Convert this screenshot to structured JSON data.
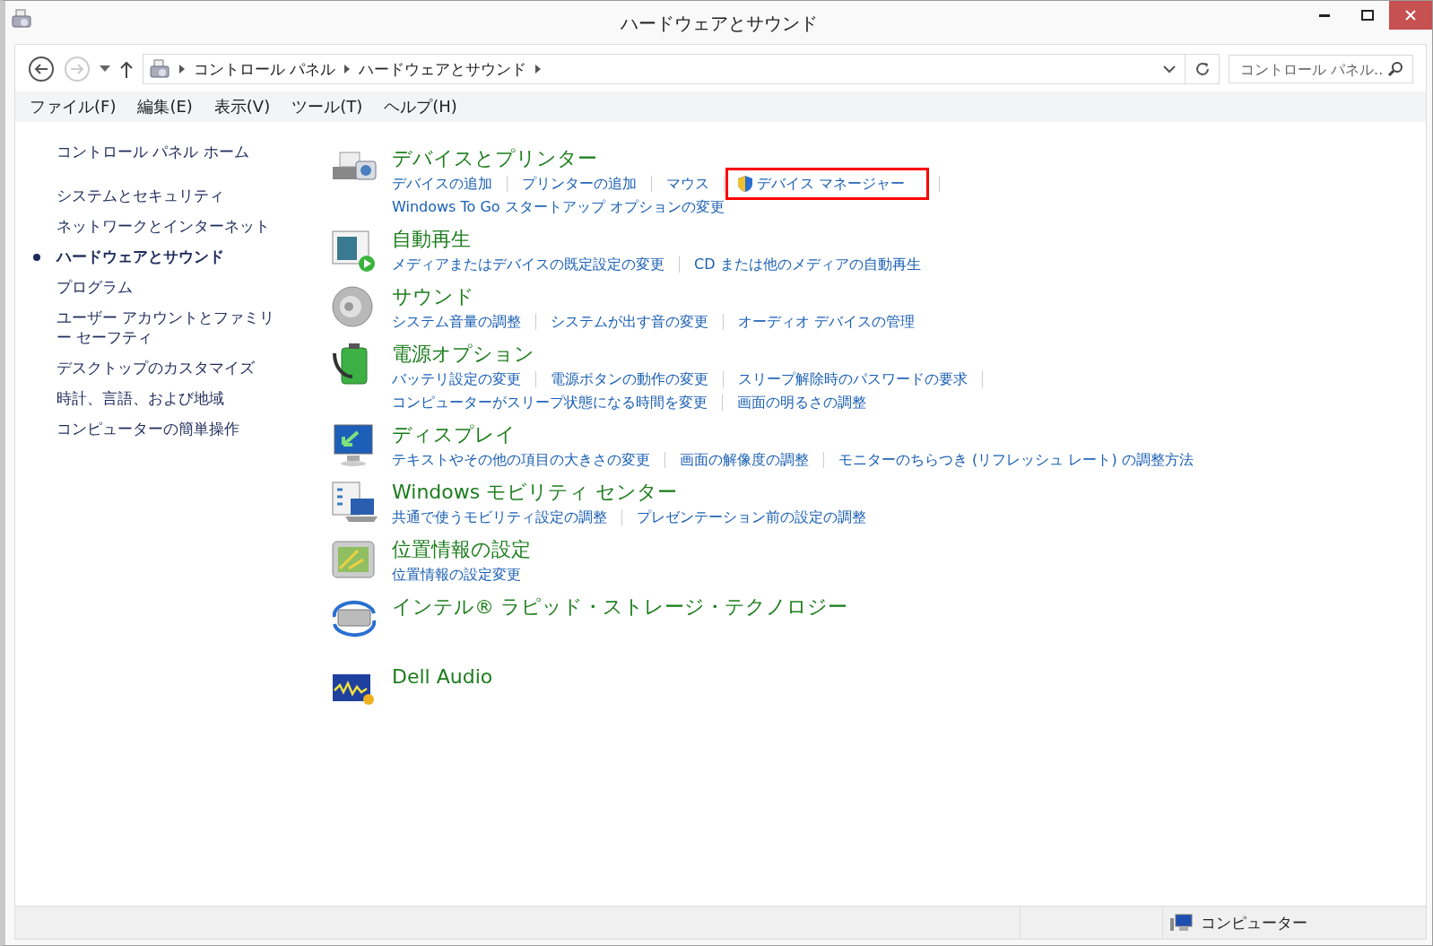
{
  "window": {
    "title": "ハードウェアとサウンド"
  },
  "address_bar": {
    "crumbs": [
      "コントロール パネル",
      "ハードウェアとサウンド"
    ],
    "search_placeholder": "コントロール パネル..."
  },
  "menu": [
    "ファイル(F)",
    "編集(E)",
    "表示(V)",
    "ツール(T)",
    "ヘルプ(H)"
  ],
  "sidebar": {
    "home": "コントロール パネル ホーム",
    "items": [
      {
        "label": "システムとセキュリティ",
        "selected": false
      },
      {
        "label": "ネットワークとインターネット",
        "selected": false
      },
      {
        "label": "ハードウェアとサウンド",
        "selected": true
      },
      {
        "label": "プログラム",
        "selected": false
      },
      {
        "label": "ユーザー アカウントとファミリー セーフティ",
        "selected": false
      },
      {
        "label": "デスクトップのカスタマイズ",
        "selected": false
      },
      {
        "label": "時計、言語、および地域",
        "selected": false
      },
      {
        "label": "コンピューターの簡単操作",
        "selected": false
      }
    ]
  },
  "categories": [
    {
      "title": "デバイスとプリンター",
      "lines": [
        [
          {
            "text": "デバイスの追加",
            "kind": "plain",
            "highlighted": false
          },
          {
            "text": "プリンターの追加",
            "kind": "plain",
            "highlighted": false
          },
          {
            "text": "マウス",
            "kind": "plain",
            "highlighted": false
          },
          {
            "text": "デバイス マネージャー",
            "kind": "shield",
            "highlighted": true
          }
        ],
        [
          {
            "text": "Windows To Go スタートアップ オプションの変更",
            "kind": "plain",
            "highlighted": false
          }
        ]
      ]
    },
    {
      "title": "自動再生",
      "lines": [
        [
          {
            "text": "メディアまたはデバイスの既定設定の変更",
            "kind": "plain",
            "highlighted": false
          },
          {
            "text": "CD または他のメディアの自動再生",
            "kind": "plain",
            "highlighted": false
          }
        ]
      ]
    },
    {
      "title": "サウンド",
      "lines": [
        [
          {
            "text": "システム音量の調整",
            "kind": "plain",
            "highlighted": false
          },
          {
            "text": "システムが出す音の変更",
            "kind": "plain",
            "highlighted": false
          },
          {
            "text": "オーディオ デバイスの管理",
            "kind": "plain",
            "highlighted": false
          }
        ]
      ]
    },
    {
      "title": "電源オプション",
      "lines": [
        [
          {
            "text": "バッテリ設定の変更",
            "kind": "plain",
            "highlighted": false
          },
          {
            "text": "電源ボタンの動作の変更",
            "kind": "plain",
            "highlighted": false
          },
          {
            "text": "スリープ解除時のパスワードの要求",
            "kind": "plain",
            "highlighted": false
          }
        ],
        [
          {
            "text": "コンピューターがスリープ状態になる時間を変更",
            "kind": "plain",
            "highlighted": false
          },
          {
            "text": "画面の明るさの調整",
            "kind": "plain",
            "highlighted": false
          }
        ]
      ]
    },
    {
      "title": "ディスプレイ",
      "lines": [
        [
          {
            "text": "テキストやその他の項目の大きさの変更",
            "kind": "plain",
            "highlighted": false
          },
          {
            "text": "画面の解像度の調整",
            "kind": "plain",
            "highlighted": false
          },
          {
            "text": "モニターのちらつき (リフレッシュ レート) の調整方法",
            "kind": "plain",
            "highlighted": false
          }
        ]
      ]
    },
    {
      "title": "Windows モビリティ センター",
      "lines": [
        [
          {
            "text": "共通で使うモビリティ設定の調整",
            "kind": "plain",
            "highlighted": false
          },
          {
            "text": "プレゼンテーション前の設定の調整",
            "kind": "plain",
            "highlighted": false
          }
        ]
      ]
    },
    {
      "title": "位置情報の設定",
      "lines": [
        [
          {
            "text": "位置情報の設定変更",
            "kind": "plain",
            "highlighted": false
          }
        ]
      ]
    },
    {
      "title": "インテル® ラピッド・ストレージ・テクノロジー"
    },
    {
      "title": "Dell Audio"
    }
  ],
  "status_bar": {
    "location": "コンピューター"
  }
}
